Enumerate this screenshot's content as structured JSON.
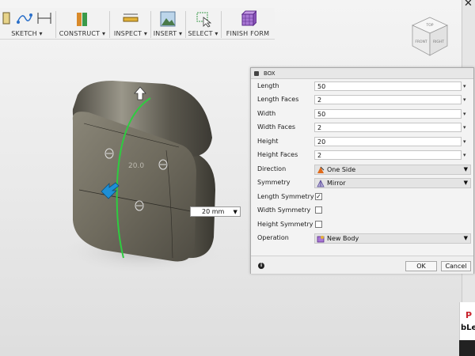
{
  "toolbar": {
    "groups": [
      {
        "label": "SKETCH ▾"
      },
      {
        "label": "CONSTRUCT ▾"
      },
      {
        "label": "INSPECT ▾"
      },
      {
        "label": "INSERT ▾"
      },
      {
        "label": "SELECT ▾"
      },
      {
        "label": "FINISH FORM"
      }
    ]
  },
  "viewcube": {
    "top": "TOP",
    "front": "FRONT",
    "right": "RIGHT"
  },
  "canvas": {
    "dimension_label": "20.0",
    "dimension_input": "20 mm"
  },
  "dialog": {
    "title": "BOX",
    "rows": [
      {
        "label": "Length",
        "value": "50"
      },
      {
        "label": "Length Faces",
        "value": "2"
      },
      {
        "label": "Width",
        "value": "50"
      },
      {
        "label": "Width Faces",
        "value": "2"
      },
      {
        "label": "Height",
        "value": "20"
      },
      {
        "label": "Height Faces",
        "value": "2"
      },
      {
        "label": "Direction",
        "value": "One Side"
      },
      {
        "label": "Symmetry",
        "value": "Mirror"
      },
      {
        "label": "Length Symmetry",
        "checked": "✓"
      },
      {
        "label": "Width Symmetry",
        "checked": ""
      },
      {
        "label": "Height Symmetry",
        "checked": ""
      },
      {
        "label": "Operation",
        "value": "New Body"
      }
    ],
    "ok_label": "OK",
    "cancel_label": "Cancel"
  },
  "background_app": {
    "partial_text": "bLea"
  },
  "colors": {
    "accent_green": "#2ecc40",
    "selection_blue": "#1e8fd6",
    "operation_purple": "#8e44ad"
  }
}
